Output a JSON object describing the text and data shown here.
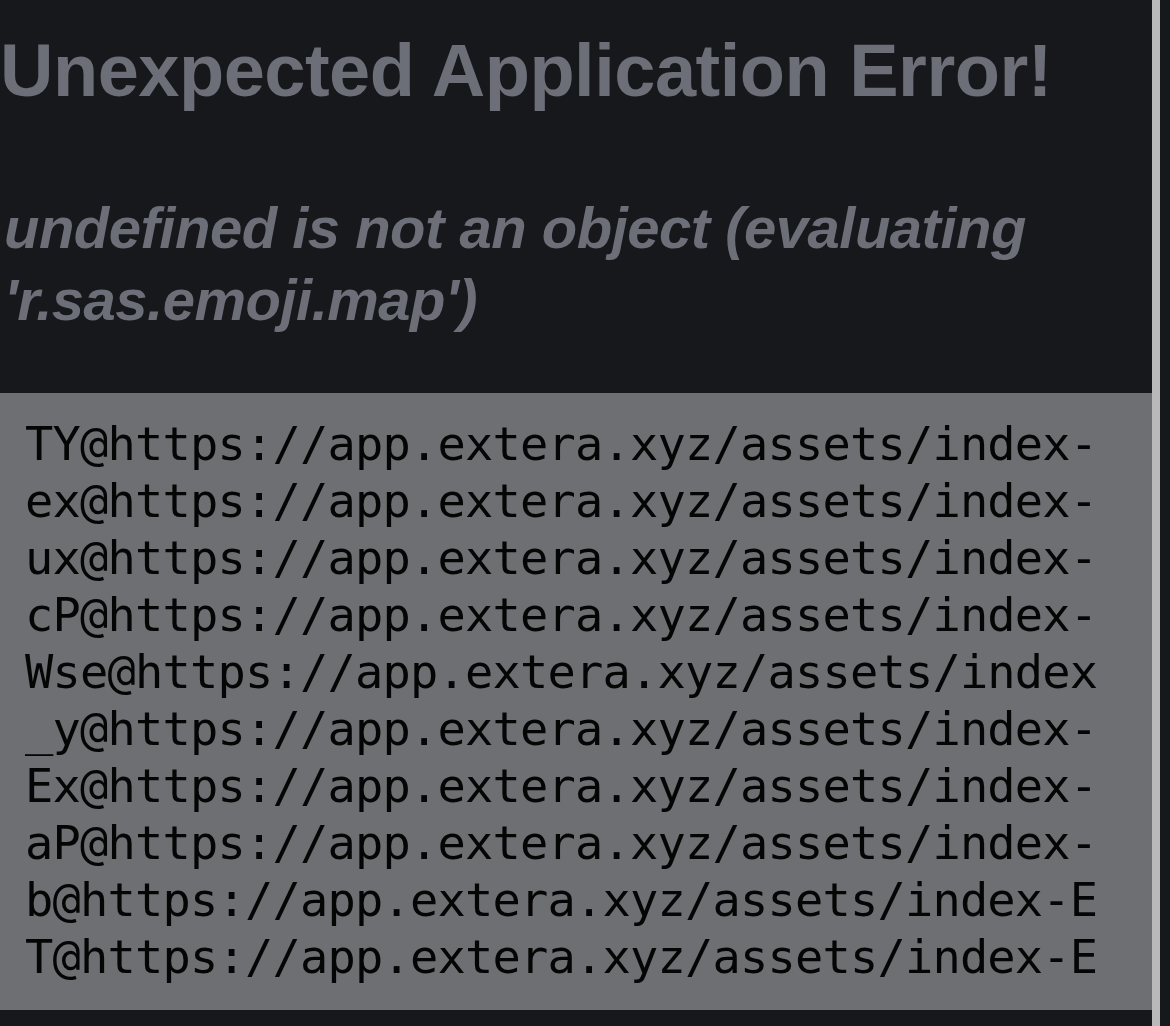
{
  "title": "Unexpected Application Error!",
  "message": "undefined is not an object (evaluating 'r.sas.emoji.map')",
  "stack_lines": [
    "TY@https://app.extera.xyz/assets/index-",
    "ex@https://app.extera.xyz/assets/index-",
    "ux@https://app.extera.xyz/assets/index-",
    "cP@https://app.extera.xyz/assets/index-",
    "Wse@https://app.extera.xyz/assets/index",
    "_y@https://app.extera.xyz/assets/index-",
    "Ex@https://app.extera.xyz/assets/index-",
    "aP@https://app.extera.xyz/assets/index-",
    "b@https://app.extera.xyz/assets/index-E",
    "T@https://app.extera.xyz/assets/index-E"
  ]
}
